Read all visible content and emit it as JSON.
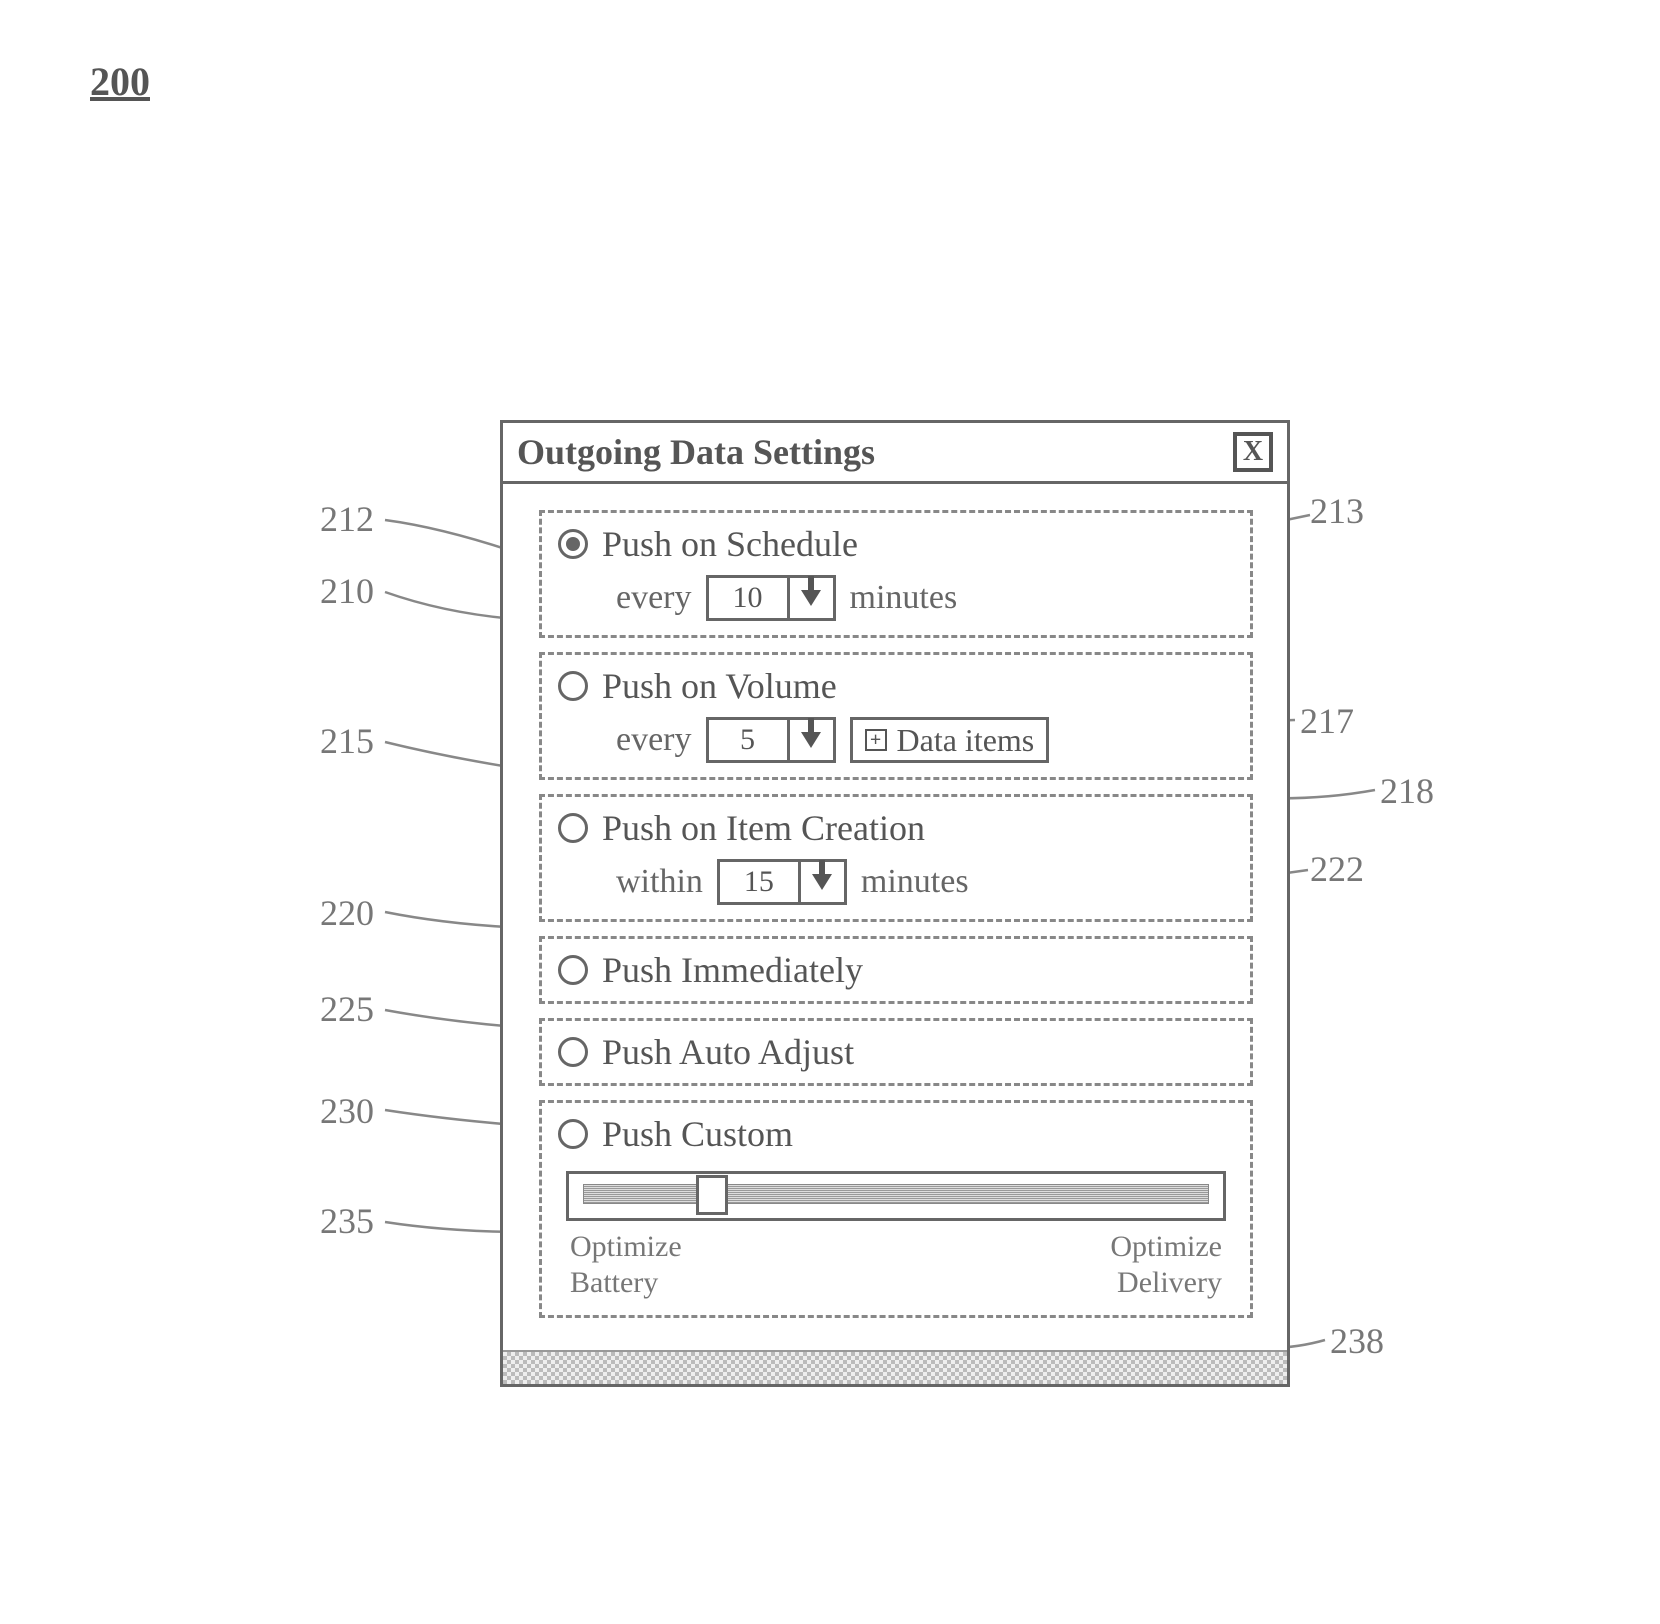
{
  "figure_number": "200",
  "dialog": {
    "title": "Outgoing Data Settings",
    "close_icon": "X",
    "options": {
      "schedule": {
        "label": "Push on Schedule",
        "prefix": "every",
        "value": "10",
        "suffix": "minutes",
        "selected": true
      },
      "volume": {
        "label": "Push on Volume",
        "prefix": "every",
        "value": "5",
        "data_items_label": "Data items",
        "selected": false
      },
      "creation": {
        "label": "Push on Item Creation",
        "prefix": "within",
        "value": "15",
        "suffix": "minutes",
        "selected": false
      },
      "immediately": {
        "label": "Push Immediately",
        "selected": false
      },
      "auto": {
        "label": "Push Auto Adjust",
        "selected": false
      },
      "custom": {
        "label": "Push Custom",
        "selected": false,
        "slider": {
          "position_percent": 18,
          "left_label_line1": "Optimize",
          "left_label_line2": "Battery",
          "right_label_line1": "Optimize",
          "right_label_line2": "Delivery"
        }
      }
    }
  },
  "callouts": {
    "c200": "200",
    "c210": "210",
    "c212": "212",
    "c213": "213",
    "c215": "215",
    "c217": "217",
    "c218": "218",
    "c220": "220",
    "c222": "222",
    "c225": "225",
    "c230": "230",
    "c235": "235",
    "c238": "238"
  }
}
